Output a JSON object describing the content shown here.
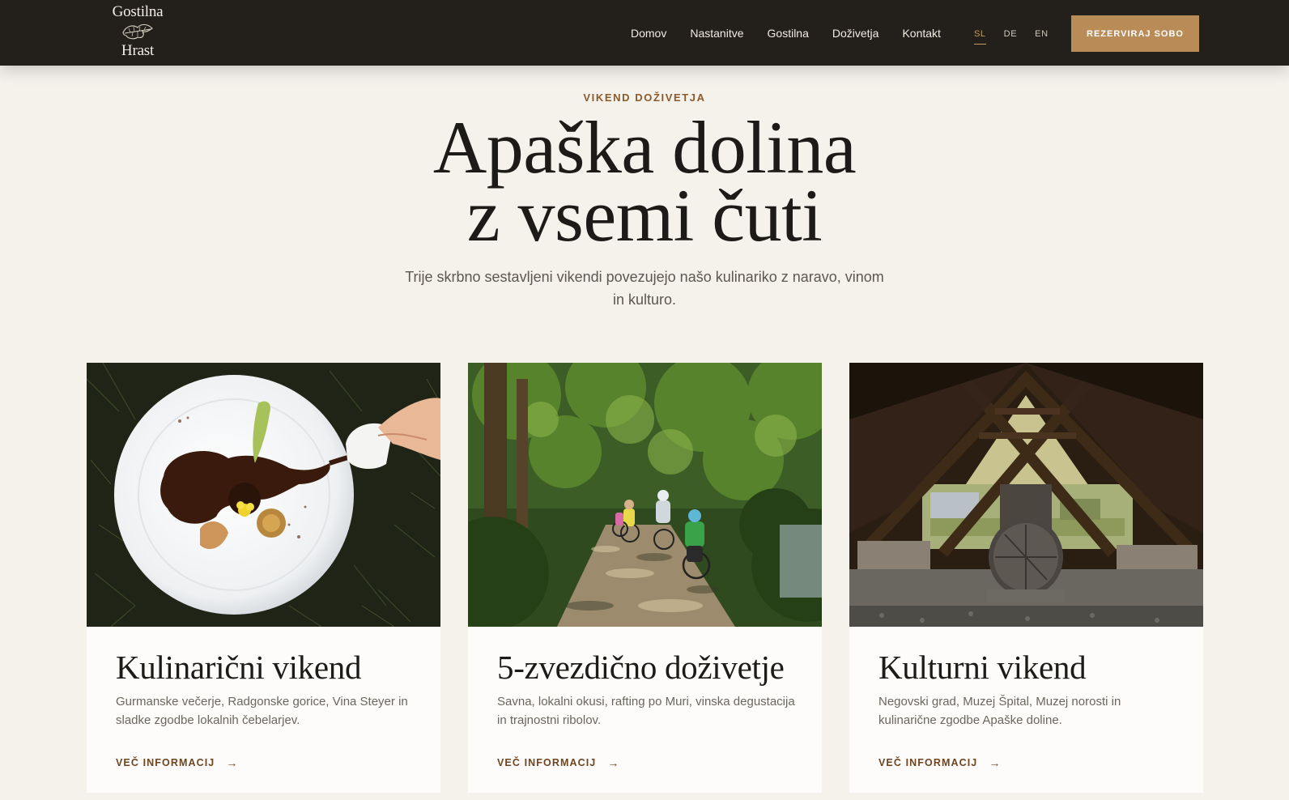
{
  "header": {
    "logo": {
      "line1": "Gostilna",
      "line2": "Hrast",
      "icon": "oak-leaf-icon"
    },
    "nav": [
      "Domov",
      "Nastanitve",
      "Gostilna",
      "Doživetja",
      "Kontakt"
    ],
    "languages": [
      {
        "code": "SL",
        "active": true
      },
      {
        "code": "DE",
        "active": false
      },
      {
        "code": "EN",
        "active": false
      }
    ],
    "cta_label": "REZERVIRAJ SOBO"
  },
  "hero": {
    "eyebrow": "VIKEND DOŽIVETJA",
    "title_line1": "Apaška dolina",
    "title_line2": "z vsemi čuti",
    "lead": "Trije skrbno sestavljeni vikendi povezujejo našo kulinariko z naravo, vinom in kulturo."
  },
  "cards": [
    {
      "title": "Kulinarični vikend",
      "text": "Gurmanske večerje, Radgonske gorice, Vina Steyer in sladke zgodbe lokalnih čebelarjev.",
      "link": "VEČ INFORMACIJ",
      "image": "plated-dish-sauce-pour"
    },
    {
      "title": "5-zvezdično doživetje",
      "text": "Savna, lokalni okusi, rafting po Muri, vinska degustacija in trajnostni ribolov.",
      "link": "VEČ INFORMACIJ",
      "image": "cyclists-forest-path"
    },
    {
      "title": "Kulturni vikend",
      "text": "Negovski grad, Muzej Špital, Muzej norosti in kulinarične zgodbe Apaške doline.",
      "link": "VEČ INFORMACIJ",
      "image": "wooden-pavilion-log"
    }
  ],
  "colors": {
    "header_bg": "#23201c",
    "accent": "#b98b57",
    "page_bg": "#f5f2ec",
    "link": "#6e4520"
  }
}
